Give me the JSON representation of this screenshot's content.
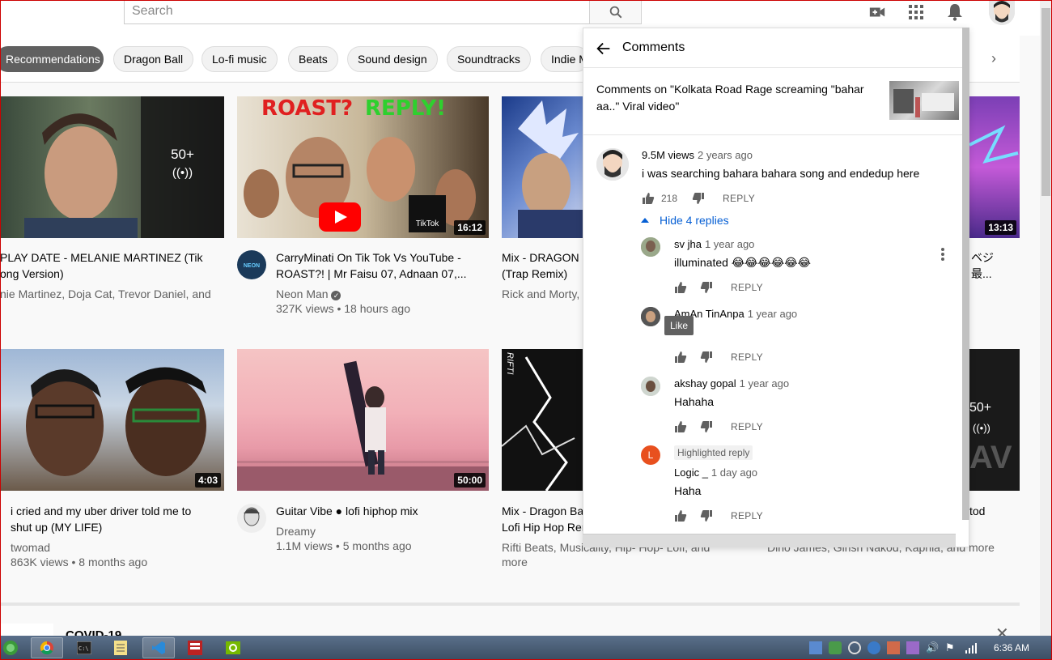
{
  "search": {
    "placeholder": "Search"
  },
  "chips": [
    "Recommendations",
    "Dragon Ball",
    "Lo-fi music",
    "Beats",
    "Sound design",
    "Soundtracks",
    "Indie M"
  ],
  "videos": [
    {
      "title_l1": "PLAY DATE - MELANIE MARTINEZ (Tik",
      "title_l2": "ong Version)",
      "channel": "nie Martinez, Doja Cat, Trevor Daniel, and",
      "badge": "50+"
    },
    {
      "title_l1": "CarryMinati On Tik Tok Vs YouTube -",
      "title_l2": "ROAST?! | Mr Faisu 07, Adnaan 07,...",
      "channel": "Neon Man",
      "stats": "327K views • 18 hours ago",
      "duration": "16:12",
      "overlay_left": "ROAST?",
      "overlay_right": "REPLY!",
      "tiktok": "TikTok",
      "avatar_text": "NEON MAN"
    },
    {
      "title_l1": "Mix - DRAGON B",
      "title_l2": "(Trap Remix)",
      "channel": "Rick and Morty,",
      "duration": "13:13",
      "side_text_l1": "ベジ",
      "side_text_l2": "最..."
    },
    {
      "title_l1": "i cried and my uber driver told me to",
      "title_l2": "shut up (MY LIFE)",
      "channel": "twomad",
      "stats": "863K views • 8 months ago",
      "duration": "4:03"
    },
    {
      "title_l1": "Guitar Vibe ● lofi hiphop mix",
      "channel": "Dreamy",
      "stats": "1.1M views • 5 months ago",
      "duration": "50:00"
    },
    {
      "title_l1": "Mix - Dragon Ba",
      "title_l2": "Lofi Hip Hop Ren",
      "title_r": "tod",
      "channel": "Rifti Beats, Musicality, Hip- Hop- Lofi, and",
      "channel_l2": "more",
      "channel_r": "Dino James, Girish Nakod, Kaprila, and more",
      "badge": "50+",
      "tile_letters": "AV",
      "rifti": "RIFTI"
    }
  ],
  "covid": {
    "title": "COVID-19"
  },
  "comments_panel": {
    "title": "Comments",
    "context": "Comments on \"Kolkata Road Rage screaming \"bahar aa..\" Viral video\"",
    "top_comment": {
      "author": "9.5M views",
      "time": "2 years ago",
      "text": "i was searching bahara bahara song and endedup here",
      "likes": "218",
      "reply_label": "REPLY"
    },
    "hide_replies": "Hide 4 replies",
    "replies": [
      {
        "author": "sv jha",
        "time": "1 year ago",
        "text": "illuminated 😂😂😂😂😂😂",
        "reply_label": "REPLY"
      },
      {
        "author": "AmAn TinAnpa",
        "time": "1 year ago",
        "text": "",
        "reply_label": "REPLY"
      },
      {
        "author": "akshay gopal",
        "time": "1 year ago",
        "text": "Hahaha",
        "reply_label": "REPLY"
      },
      {
        "author": "Logic _",
        "time": "1 day ago",
        "text": "Haha",
        "reply_label": "REPLY",
        "badge": "Highlighted reply",
        "initial": "L"
      }
    ],
    "tooltip": "Like"
  },
  "taskbar": {
    "clock": "6:36 AM"
  },
  "colors": {
    "link_blue": "#065fd4",
    "logic_avatar": "#e8501e"
  }
}
